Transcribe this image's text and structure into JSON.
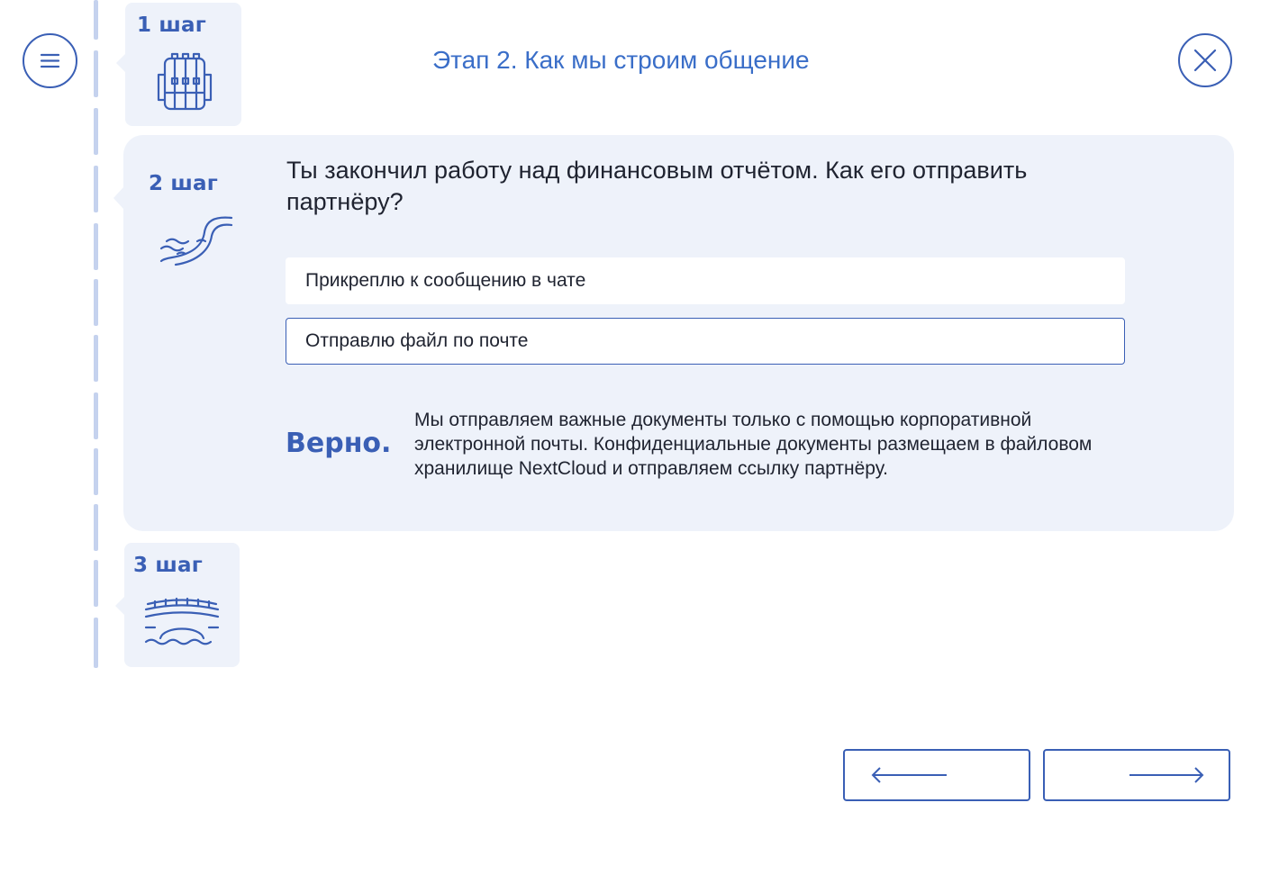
{
  "header": {
    "title": "Этап 2. Как мы строим общение",
    "menu_icon": "menu-icon",
    "close_icon": "close-icon"
  },
  "steps": [
    {
      "label": "1 шаг",
      "icon": "backpack-icon"
    },
    {
      "label": "2 шаг",
      "icon": "river-icon"
    },
    {
      "label": "3 шаг",
      "icon": "bridge-icon"
    }
  ],
  "question": {
    "text": "Ты закончил работу над финансовым отчётом. Как его отправить партнёру?",
    "options": [
      {
        "label": "Прикреплю к сообщению в чате",
        "selected": false
      },
      {
        "label": "Отправлю файл по почте",
        "selected": true
      }
    ]
  },
  "feedback": {
    "verdict": "Верно.",
    "explanation": "Мы отправляем важные документы только с помощью корпоративной электронной почты. Конфиденциальные документы размещаем в файловом хранилище NextCloud и отправляем ссылку партнёру."
  },
  "navigation": {
    "prev_icon": "arrow-left-icon",
    "next_icon": "arrow-right-icon"
  },
  "colors": {
    "accent": "#3a5fb5",
    "title": "#3a6ec8",
    "panel": "#eef2fa",
    "timeline": "#c5d2ee"
  }
}
